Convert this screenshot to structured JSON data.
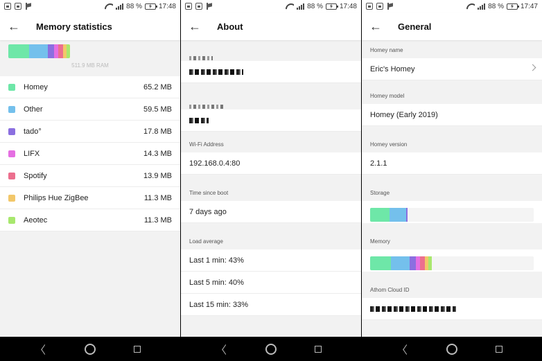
{
  "status": {
    "battery": "88 %",
    "times": [
      "17:48",
      "17:48",
      "17:47"
    ]
  },
  "memory_screen": {
    "title": "Memory statistics",
    "ram_total": "511.9 MB RAM",
    "apps": [
      {
        "name": "Homey",
        "size": "65.2 MB",
        "color": "#6ee7a8"
      },
      {
        "name": "Other",
        "size": "59.5 MB",
        "color": "#74c0ec"
      },
      {
        "name": "tado°",
        "size": "17.8 MB",
        "color": "#8b6fe0"
      },
      {
        "name": "LIFX",
        "size": "14.3 MB",
        "color": "#e56fe2"
      },
      {
        "name": "Spotify",
        "size": "13.9 MB",
        "color": "#ec6f8e"
      },
      {
        "name": "Philips Hue ZigBee",
        "size": "11.3 MB",
        "color": "#f2c76a"
      },
      {
        "name": "Aeotec",
        "size": "11.3 MB",
        "color": "#a8e86e"
      }
    ]
  },
  "about_screen": {
    "title": "About",
    "wifi_label": "Wi-Fi Address",
    "wifi_value": "192.168.0.4:80",
    "boot_label": "Time since boot",
    "boot_value": "7 days ago",
    "load_label": "Load average",
    "load_values": [
      "Last 1 min: 43%",
      "Last 5 min: 40%",
      "Last 15 min: 33%"
    ]
  },
  "general_screen": {
    "title": "General",
    "name_label": "Homey name",
    "name_value": "Eric's Homey",
    "model_label": "Homey model",
    "model_value": "Homey (Early 2019)",
    "version_label": "Homey version",
    "version_value": "2.1.1",
    "storage_label": "Storage",
    "storage_segments": [
      {
        "fraction": 0.12,
        "color": "#6ee7a8"
      },
      {
        "fraction": 0.1,
        "color": "#74c0ec"
      },
      {
        "fraction": 0.01,
        "color": "#8b6fe0"
      }
    ],
    "memory_label": "Memory",
    "cloud_label": "Athom Cloud ID"
  }
}
